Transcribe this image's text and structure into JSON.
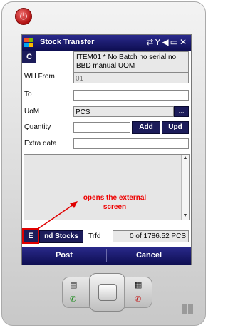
{
  "titlebar": {
    "title": "Stock Transfer",
    "icons": [
      "connectivity-icon",
      "no-signal-icon",
      "volume-icon",
      "battery-icon",
      "close-icon"
    ]
  },
  "form": {
    "c_button": "C",
    "item_value": "ITEM01 * No Batch no serial no BBD manual UOM",
    "wh_from_label": "WH From",
    "wh_from_value": "01",
    "to_label": "To",
    "to_value": "",
    "uom_label": "UoM",
    "uom_value": "PCS",
    "uom_browse_label": "...",
    "quantity_label": "Quantity",
    "quantity_value": "",
    "add_label": "Add",
    "upd_label": "Upd",
    "extra_label": "Extra data",
    "extra_value": ""
  },
  "annotation": {
    "text": "opens the external screen",
    "color": "#ee0000"
  },
  "bottom": {
    "e_label": "E",
    "stocks_label": "nd Stocks",
    "trfd_label": "Trfd",
    "trfd_value": "0 of 1786.52 PCS"
  },
  "softkeys": {
    "left": "Post",
    "right": "Cancel"
  },
  "colors": {
    "accent": "#1c1c5a",
    "annotation": "#ee0000"
  }
}
